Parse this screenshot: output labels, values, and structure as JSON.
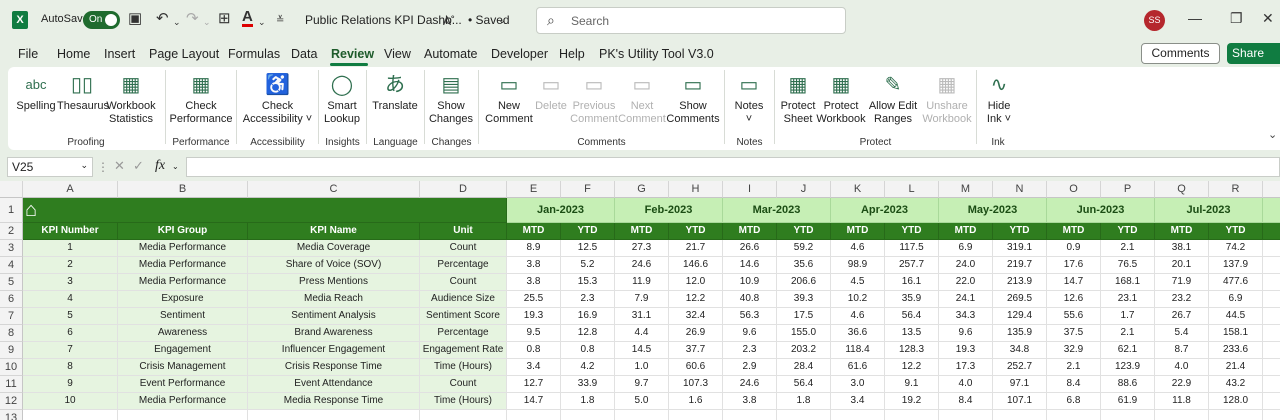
{
  "titlebar": {
    "autosave": "AutoSave",
    "toggle": "On",
    "doc_title": "Public Relations KPI Dashb...",
    "saved": "• Saved",
    "search_placeholder": "Search",
    "user_initials": "SS"
  },
  "menu": {
    "items": [
      "File",
      "Home",
      "Insert",
      "Page Layout",
      "Formulas",
      "Data",
      "Review",
      "View",
      "Automate",
      "Developer",
      "Help",
      "PK's Utility Tool V3.0"
    ],
    "active": "Review",
    "comments": "Comments",
    "share": "Share"
  },
  "ribbon": {
    "buttons": [
      {
        "label": "Spelling",
        "icon": "abc"
      },
      {
        "label": "Thesaurus",
        "icon": "book"
      },
      {
        "label": "Workbook\nStatistics",
        "icon": "grid"
      },
      {
        "label": "Check\nPerformance",
        "icon": "perf"
      },
      {
        "label": "Check\nAccessibility ˅",
        "icon": "person"
      },
      {
        "label": "Smart\nLookup",
        "icon": "bulb"
      },
      {
        "label": "Translate",
        "icon": "translate"
      },
      {
        "label": "Show\nChanges",
        "icon": "sheet"
      },
      {
        "label": "New\nComment",
        "icon": "comment"
      },
      {
        "label": "Delete",
        "icon": "comment"
      },
      {
        "label": "Previous\nComment",
        "icon": "comment"
      },
      {
        "label": "Next\nComment",
        "icon": "comment"
      },
      {
        "label": "Show\nComments",
        "icon": "comment"
      },
      {
        "label": "Notes\n˅",
        "icon": "note"
      },
      {
        "label": "Protect\nSheet",
        "icon": "lock"
      },
      {
        "label": "Protect\nWorkbook",
        "icon": "lock"
      },
      {
        "label": "Allow Edit\nRanges",
        "icon": "range"
      },
      {
        "label": "Unshare\nWorkbook",
        "icon": "share"
      },
      {
        "label": "Hide\nInk ˅",
        "icon": "ink"
      }
    ],
    "groups": [
      "Proofing",
      "Performance",
      "Accessibility",
      "Insights",
      "Language",
      "Changes",
      "Comments",
      "Notes",
      "Protect",
      "Ink"
    ]
  },
  "formula_bar": {
    "name_box": "V25",
    "fx": "fx",
    "formula": ""
  },
  "sheet": {
    "columns": [
      "A",
      "B",
      "C",
      "D",
      "E",
      "F",
      "G",
      "H",
      "I",
      "J",
      "K",
      "L",
      "M",
      "N",
      "O",
      "P",
      "Q",
      "R"
    ],
    "row_numbers": [
      "1",
      "2",
      "3",
      "4",
      "5",
      "6",
      "7",
      "8",
      "9",
      "10",
      "11",
      "12",
      "13"
    ],
    "months": [
      "Jan-2023",
      "Feb-2023",
      "Mar-2023",
      "Apr-2023",
      "May-2023",
      "Jun-2023",
      "Jul-2023"
    ],
    "sub_headers": [
      "MTD",
      "YTD"
    ],
    "headers": [
      "KPI Number",
      "KPI Group",
      "KPI Name",
      "Unit"
    ],
    "rows": [
      [
        "1",
        "Media Performance",
        "Media Coverage",
        "Count",
        "8.9",
        "12.5",
        "27.3",
        "21.7",
        "26.6",
        "59.2",
        "4.6",
        "117.5",
        "6.9",
        "319.1",
        "0.9",
        "2.1",
        "38.1",
        "74.2"
      ],
      [
        "2",
        "Media Performance",
        "Share of Voice (SOV)",
        "Percentage",
        "3.8",
        "5.2",
        "24.6",
        "146.6",
        "14.6",
        "35.6",
        "98.9",
        "257.7",
        "24.0",
        "219.7",
        "17.6",
        "76.5",
        "20.1",
        "137.9"
      ],
      [
        "3",
        "Media Performance",
        "Press Mentions",
        "Count",
        "3.8",
        "15.3",
        "11.9",
        "12.0",
        "10.9",
        "206.6",
        "4.5",
        "16.1",
        "22.0",
        "213.9",
        "14.7",
        "168.1",
        "71.9",
        "477.6"
      ],
      [
        "4",
        "Exposure",
        "Media Reach",
        "Audience Size",
        "25.5",
        "2.3",
        "7.9",
        "12.2",
        "40.8",
        "39.3",
        "10.2",
        "35.9",
        "24.1",
        "269.5",
        "12.6",
        "23.1",
        "23.2",
        "6.9"
      ],
      [
        "5",
        "Sentiment",
        "Sentiment Analysis",
        "Sentiment Score",
        "19.3",
        "16.9",
        "31.1",
        "32.4",
        "56.3",
        "17.5",
        "4.6",
        "56.4",
        "34.3",
        "129.4",
        "55.6",
        "1.7",
        "26.7",
        "44.5"
      ],
      [
        "6",
        "Awareness",
        "Brand Awareness",
        "Percentage",
        "9.5",
        "12.8",
        "4.4",
        "26.9",
        "9.6",
        "155.0",
        "36.6",
        "13.5",
        "9.6",
        "135.9",
        "37.5",
        "2.1",
        "5.4",
        "158.1"
      ],
      [
        "7",
        "Engagement",
        "Influencer Engagement",
        "Engagement Rate",
        "0.8",
        "0.8",
        "14.5",
        "37.7",
        "2.3",
        "203.2",
        "118.4",
        "128.3",
        "19.3",
        "34.8",
        "32.9",
        "62.1",
        "8.7",
        "233.6"
      ],
      [
        "8",
        "Crisis Management",
        "Crisis Response Time",
        "Time (Hours)",
        "3.4",
        "4.2",
        "1.0",
        "60.6",
        "2.9",
        "28.4",
        "61.6",
        "12.2",
        "17.3",
        "252.7",
        "2.1",
        "123.9",
        "4.0",
        "21.4"
      ],
      [
        "9",
        "Event Performance",
        "Event Attendance",
        "Count",
        "12.7",
        "33.9",
        "9.7",
        "107.3",
        "24.6",
        "56.4",
        "3.0",
        "9.1",
        "4.0",
        "97.1",
        "8.4",
        "88.6",
        "22.9",
        "43.2"
      ],
      [
        "10",
        "Media Performance",
        "Media Response Time",
        "Time (Hours)",
        "14.7",
        "1.8",
        "5.0",
        "1.6",
        "3.8",
        "1.8",
        "3.4",
        "19.2",
        "8.4",
        "107.1",
        "6.8",
        "61.9",
        "11.8",
        "128.0"
      ]
    ]
  }
}
